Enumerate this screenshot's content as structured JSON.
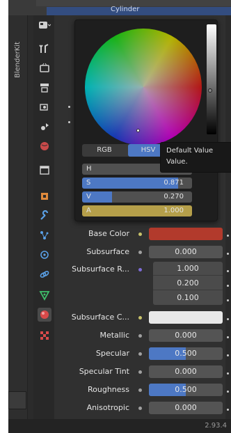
{
  "topbar": {
    "object_name": "Cylinder"
  },
  "side_tab": {
    "label": "BlenderKit"
  },
  "toolbar_icons": [
    "tool-icon",
    "scene-icon",
    "render-icon",
    "output-icon",
    "view-layer-icon",
    "world-icon",
    "collection-icon",
    "object-icon",
    "modifier-icon",
    "particles-icon",
    "physics-icon",
    "constraints-icon",
    "data-icon",
    "material-icon",
    "texture-icon"
  ],
  "picker": {
    "modes": [
      "RGB",
      "HSV"
    ],
    "active_mode": "HSV",
    "fields": [
      {
        "label": "H",
        "value": ""
      },
      {
        "label": "S",
        "value": "0.871",
        "fill_fraction": 0.871
      },
      {
        "label": "V",
        "value": "0.270",
        "fill_fraction": 0.27
      },
      {
        "label": "A",
        "value": "1.000"
      }
    ]
  },
  "tooltip": {
    "line1": "Default Value",
    "line2": "Value."
  },
  "properties": {
    "base_color": {
      "label": "Base Color",
      "color": "#b23a2c"
    },
    "subsurface": {
      "label": "Subsurface",
      "value": "0.000"
    },
    "subsurface_radius": {
      "label": "Subsurface R...",
      "values": [
        "1.000",
        "0.200",
        "0.100"
      ]
    },
    "subsurface_color": {
      "label": "Subsurface C...",
      "color": "#e8e8e8"
    },
    "metallic": {
      "label": "Metallic",
      "value": "0.000"
    },
    "specular": {
      "label": "Specular",
      "value": "0.500",
      "fill_fraction": 0.5
    },
    "specular_tint": {
      "label": "Specular Tint",
      "value": "0.000"
    },
    "roughness": {
      "label": "Roughness",
      "value": "0.500",
      "fill_fraction": 0.5
    },
    "anisotropic": {
      "label": "Anisotropic",
      "value": "0.000"
    }
  },
  "status": {
    "version": "2.93.4"
  },
  "colors": {
    "accent": "#4d78c4",
    "alpha_bar": "#b59f4a",
    "background": "#303030"
  }
}
